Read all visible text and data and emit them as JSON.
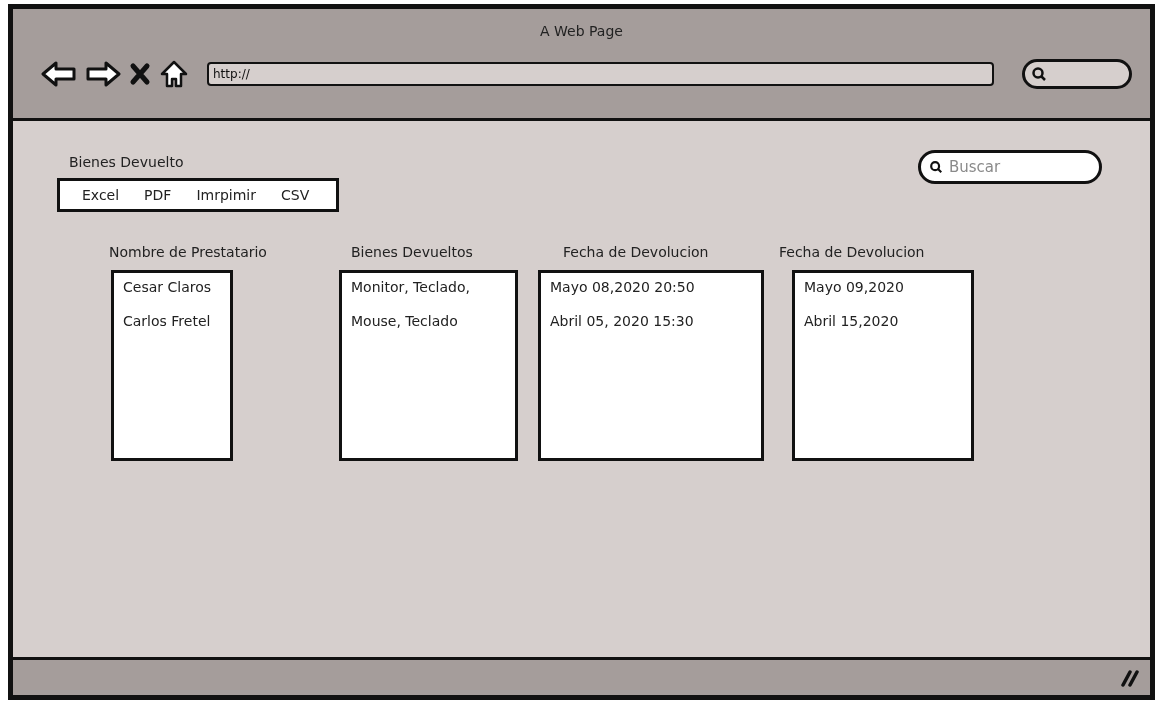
{
  "window": {
    "title": "A Web Page"
  },
  "browser": {
    "address": "http://"
  },
  "page": {
    "title": "Bienes Devuelto",
    "export_buttons": [
      "Excel",
      "PDF",
      "Imrpimir",
      "CSV"
    ],
    "search": {
      "placeholder": "Buscar"
    },
    "lists": [
      {
        "header": "Nombre de Prestatario",
        "items": [
          "Cesar Claros",
          "Carlos Fretel"
        ]
      },
      {
        "header": "Bienes Devueltos",
        "items": [
          "Monitor, Teclado,",
          "Mouse, Teclado"
        ]
      },
      {
        "header": "Fecha de Devolucion",
        "items": [
          "Mayo 08,2020 20:50",
          "Abril 05, 2020 15:30"
        ]
      },
      {
        "header": "Fecha de Devolucion",
        "items": [
          "Mayo 09,2020",
          "Abril 15,2020"
        ]
      }
    ]
  }
}
